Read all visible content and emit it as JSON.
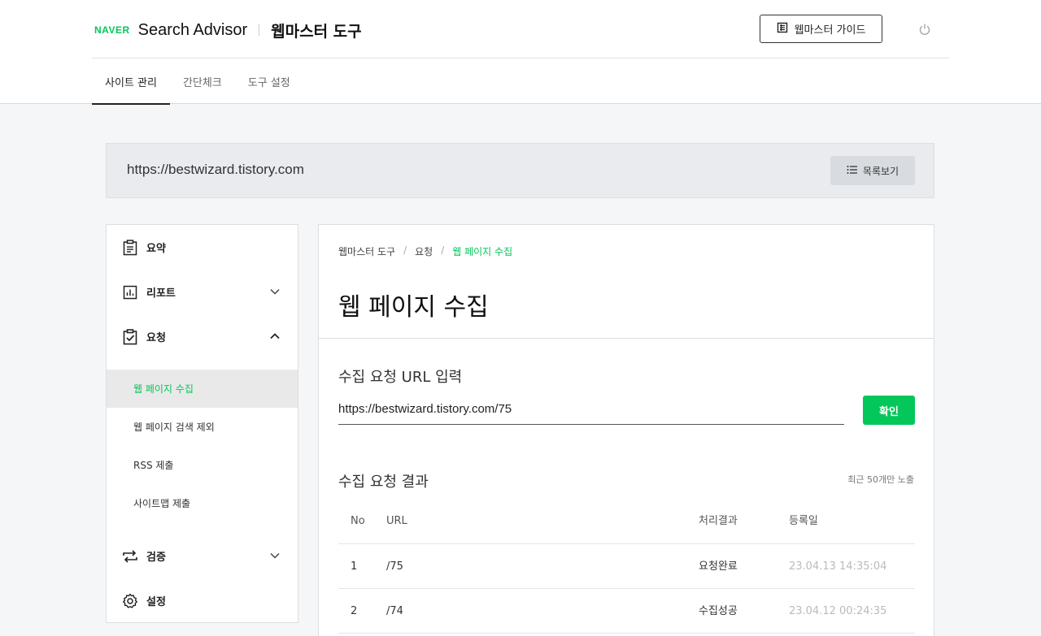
{
  "header": {
    "naver_logo": "NAVER",
    "product_name": "Search Advisor",
    "tool_name": "웹마스터 도구",
    "guide_button": "웹마스터 가이드"
  },
  "nav": {
    "tabs": [
      {
        "label": "사이트 관리",
        "active": true
      },
      {
        "label": "간단체크",
        "active": false
      },
      {
        "label": "도구 설정",
        "active": false
      }
    ]
  },
  "site": {
    "url": "https://bestwizard.tistory.com",
    "list_button": "목록보기"
  },
  "sidebar": {
    "summary": "요약",
    "report": "리포트",
    "request": "요청",
    "submenu": [
      {
        "label": "웹 페이지 수집",
        "active": true
      },
      {
        "label": "웹 페이지 검색 제외",
        "active": false
      },
      {
        "label": "RSS 제출",
        "active": false
      },
      {
        "label": "사이트맵 제출",
        "active": false
      }
    ],
    "verify": "검증",
    "settings": "설정"
  },
  "main": {
    "breadcrumb": [
      "웹마스터 도구",
      "요청",
      "웹 페이지 수집"
    ],
    "title": "웹 페이지 수집",
    "input_section_title": "수집 요청 URL 입력",
    "url_value": "https://bestwizard.tistory.com/75",
    "confirm_button": "확인",
    "result_section_title": "수집 요청 결과",
    "result_note": "최근 50개만 노출",
    "table": {
      "headers": [
        "No",
        "URL",
        "처리결과",
        "등록일"
      ],
      "rows": [
        {
          "no": "1",
          "url": "/75",
          "status": "요청완료",
          "date": "23.04.13 14:35:04"
        },
        {
          "no": "2",
          "url": "/74",
          "status": "수집성공",
          "date": "23.04.12 00:24:35"
        }
      ]
    }
  },
  "colors": {
    "accent": "#03c75a",
    "text": "#222222",
    "muted_date": "#bbbbbb"
  }
}
